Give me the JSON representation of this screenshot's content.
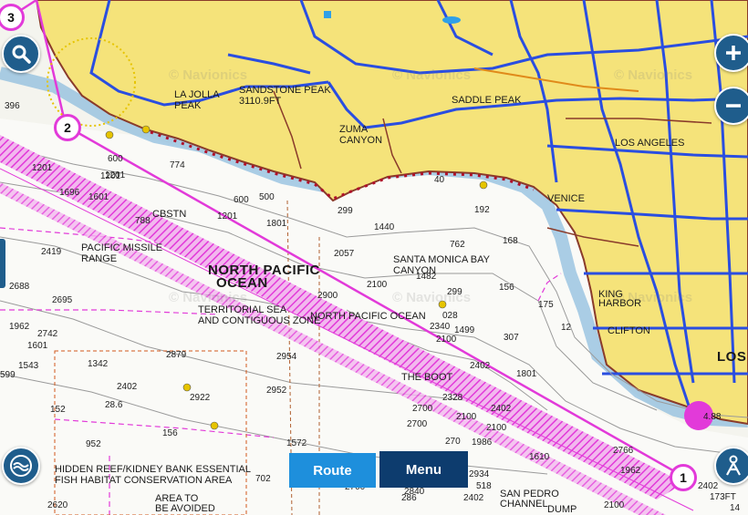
{
  "buttons": {
    "route": "Route",
    "menu": "Menu"
  },
  "waypoints": {
    "w1": "1",
    "w2": "2",
    "w3": "3"
  },
  "watermark": "© Navionics",
  "place_labels": {
    "north_pacific_1": "NORTH PACIFIC",
    "north_pacific_2": "OCEAN",
    "territorial_1": "TERRITORIAL SEA",
    "territorial_2": "AND CONTIGUOUS ZONE",
    "north_pacific_ocean": "NORTH PACIFIC OCEAN",
    "pacific_missile_1": "PACIFIC MISSILE",
    "pacific_missile_2": "RANGE",
    "la_jolla_1": "LA JOLLA",
    "la_jolla_2": "PEAK",
    "sandstone_1": "SANDSTONE PEAK",
    "sandstone_2": "3110.9FT",
    "zuma_1": "ZUMA",
    "zuma_2": "CANYON",
    "saddle_peak": "SADDLE PEAK",
    "los_angeles": "LOS ANGELES",
    "venice": "VENICE",
    "smb_1": "SANTA MONICA BAY",
    "smb_2": "CANYON",
    "king_1": "KING",
    "king_2": "HARBOR",
    "clifton": "CLIFTON",
    "los": "LOS",
    "the_boot": "THE BOOT",
    "hidden_reef_1": "HIDDEN REEF/KIDNEY BANK ESSENTIAL",
    "hidden_reef_2": "FISH HABITAT CONSERVATION AREA",
    "avoid_1": "AREA TO",
    "avoid_2": "BE AVOIDED",
    "san_pedro_1": "SAN PEDRO",
    "san_pedro_2": "CHANNEL",
    "dump": "DUMP",
    "cbstn": "CBSTN",
    "height_173": "173FT",
    "depth_488": "4.88"
  },
  "soundings": [
    "1201",
    "1201",
    "1696",
    "1601",
    "600",
    "774",
    "600",
    "500",
    "788",
    "1201",
    "1801",
    "1440",
    "762",
    "168",
    "192",
    "40",
    "299",
    "2419",
    "2688",
    "2695",
    "1962",
    "2742",
    "1601",
    "1543",
    "2879",
    "2954",
    "2900",
    "2100",
    "2057",
    "1482",
    "299",
    "156",
    "028",
    "2340",
    "1499",
    "2100",
    "307",
    "2402",
    "2402",
    "2922",
    "2952",
    "2328",
    "2700",
    "2700",
    "2100",
    "2402",
    "2100",
    "270",
    "1986",
    "1610",
    "2766",
    "1962",
    "2402",
    "156",
    "1572",
    "2934",
    "518",
    "2700",
    "2840",
    "2402",
    "286",
    "2100",
    "2620",
    "1342",
    "28.6",
    "152",
    "952",
    "702",
    "175",
    "12",
    "599",
    "396",
    "1801",
    "1201",
    "14"
  ],
  "colors": {
    "land": "#f5e37a",
    "road": "#2a4ee0",
    "route": "#e23ad9",
    "button_route": "#1e8fdc",
    "button_menu": "#0d3c6e",
    "control": "#1f5d8c"
  }
}
